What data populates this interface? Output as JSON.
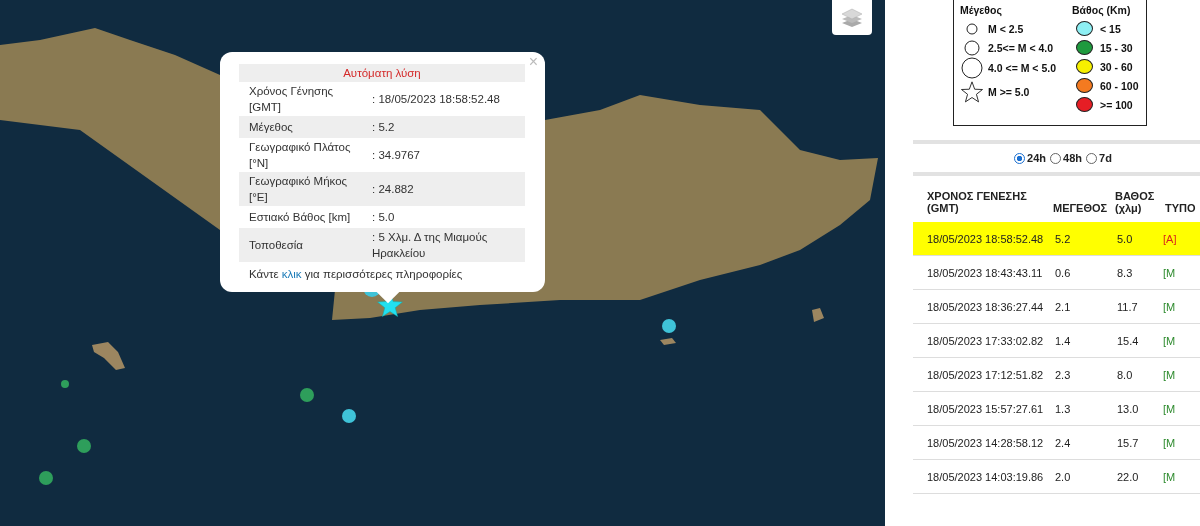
{
  "map": {
    "markers": [
      {
        "kind": "small",
        "color": "#2e9e5b"
      },
      {
        "kind": "medium",
        "color": "#2e9e5b"
      },
      {
        "kind": "medium",
        "color": "#2e9e5b"
      },
      {
        "kind": "medium",
        "color": "#2e9e5b"
      },
      {
        "kind": "medium",
        "color": "#3fc3d8"
      },
      {
        "kind": "medium",
        "color": "#3fc3d8"
      },
      {
        "kind": "large",
        "color": "#3fc3d8"
      },
      {
        "kind": "star",
        "color": "#22e0f0"
      }
    ]
  },
  "popup": {
    "title": "Αυτόματη λύση",
    "close": "×",
    "rows": [
      {
        "label": "Χρόνος Γένησης [GMT]",
        "value": ": 18/05/2023 18:58:52.48"
      },
      {
        "label": "Μέγεθος",
        "value": ": 5.2"
      },
      {
        "label": "Γεωγραφικό Πλάτος [°N]",
        "value": ": 34.9767"
      },
      {
        "label": "Γεωγραφικό Μήκος [°E]",
        "value": ": 24.882"
      },
      {
        "label": "Εστιακό Βάθος [km]",
        "value": ": 5.0"
      },
      {
        "label": "Τοποθεσία",
        "value": ": 5 Χλμ. Δ της Μιαμούς Ηρακλείου"
      }
    ],
    "footer": {
      "before": "Κάντε",
      "link": "κλικ",
      "after": "για περισσότερες πληροφορίες"
    }
  },
  "legend": {
    "magnitude_title": "Μέγεθος",
    "magnitude": [
      {
        "kind": "small",
        "label": "M < 2.5"
      },
      {
        "kind": "medium",
        "label": "2.5<= M < 4.0"
      },
      {
        "kind": "large",
        "label": "4.0 <= M < 5.0"
      },
      {
        "kind": "star",
        "label": "M >= 5.0"
      }
    ],
    "depth_title": "Βάθος (Km)",
    "depth": [
      {
        "color": "#8ef0f4",
        "label": "< 15"
      },
      {
        "color": "#1f9a3e",
        "label": "15 - 30"
      },
      {
        "color": "#f6f000",
        "label": "30 - 60"
      },
      {
        "color": "#f47a20",
        "label": "60 - 100"
      },
      {
        "color": "#e61e25",
        "label": ">= 100"
      }
    ]
  },
  "periods": [
    {
      "label": "24h",
      "selected": true
    },
    {
      "label": "48h",
      "selected": false
    },
    {
      "label": "7d",
      "selected": false
    }
  ],
  "table": {
    "columns": [
      "ΧΡΟΝΟΣ ΓΕΝΕΣΗΣ (GMT)",
      "ΜΕΓΕΘΟΣ",
      "ΒΑΘΟΣ (χλμ)",
      "ΤΥΠΟ"
    ],
    "rows": [
      {
        "selected": true,
        "time": "18/05/2023 18:58:52.48",
        "magnitude": "5.2",
        "depth": "5.0",
        "kind": "auto",
        "type": "[A]"
      },
      {
        "selected": false,
        "time": "18/05/2023 18:43:43.11",
        "magnitude": "0.6",
        "depth": "8.3",
        "kind": "manual",
        "type": "[M"
      },
      {
        "selected": false,
        "time": "18/05/2023 18:36:27.44",
        "magnitude": "2.1",
        "depth": "11.7",
        "kind": "manual",
        "type": "[M"
      },
      {
        "selected": false,
        "time": "18/05/2023 17:33:02.82",
        "magnitude": "1.4",
        "depth": "15.4",
        "kind": "manual",
        "type": "[M"
      },
      {
        "selected": false,
        "time": "18/05/2023 17:12:51.82",
        "magnitude": "2.3",
        "depth": "8.0",
        "kind": "manual",
        "type": "[M"
      },
      {
        "selected": false,
        "time": "18/05/2023 15:57:27.61",
        "magnitude": "1.3",
        "depth": "13.0",
        "kind": "manual",
        "type": "[M"
      },
      {
        "selected": false,
        "time": "18/05/2023 14:28:58.12",
        "magnitude": "2.4",
        "depth": "15.7",
        "kind": "manual",
        "type": "[M"
      },
      {
        "selected": false,
        "time": "18/05/2023 14:03:19.86",
        "magnitude": "2.0",
        "depth": "22.0",
        "kind": "manual",
        "type": "[M"
      }
    ]
  }
}
